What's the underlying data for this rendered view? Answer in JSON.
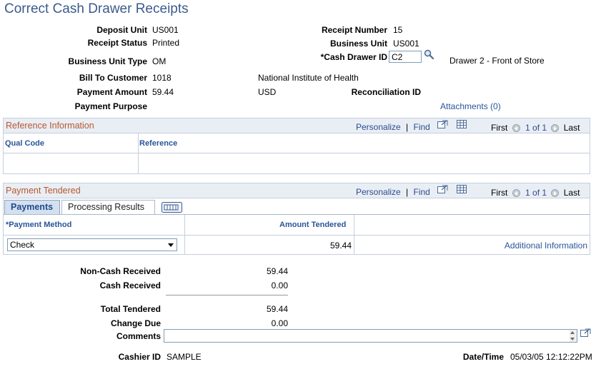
{
  "page_title": "Correct Cash Drawer Receipts",
  "header": {
    "deposit_unit_label": "Deposit Unit",
    "deposit_unit": "US001",
    "receipt_status_label": "Receipt Status",
    "receipt_status": "Printed",
    "bu_type_label": "Business Unit Type",
    "bu_type": "OM",
    "bill_to_label": "Bill To Customer",
    "bill_to": "1018",
    "bill_to_name": "National Institute of Health",
    "payment_amount_label": "Payment Amount",
    "payment_amount": "59.44",
    "currency": "USD",
    "payment_purpose_label": "Payment Purpose",
    "receipt_number_label": "Receipt Number",
    "receipt_number": "15",
    "business_unit_label": "Business Unit",
    "business_unit": "US001",
    "cash_drawer_label": "*Cash Drawer ID",
    "cash_drawer": "C2",
    "drawer_desc": "Drawer 2 - Front of Store",
    "reconciliation_label": "Reconciliation ID",
    "attachments_link": "Attachments (0)"
  },
  "reference_grid": {
    "title": "Reference Information",
    "personalize": "Personalize",
    "sep": "|",
    "find": "Find",
    "first": "First",
    "page_info": "1 of 1",
    "last": "Last",
    "columns": [
      "Qual Code",
      "Reference"
    ]
  },
  "payment_grid": {
    "title": "Payment Tendered",
    "personalize": "Personalize",
    "sep": "|",
    "find": "Find",
    "first": "First",
    "page_info": "1 of 1",
    "last": "Last",
    "tabs": [
      "Payments",
      "Processing Results"
    ],
    "columns": [
      "*Payment Method",
      "Amount Tendered"
    ],
    "row": {
      "method": "Check",
      "amount": "59.44",
      "additional_info": "Additional Information"
    }
  },
  "totals": {
    "non_cash_label": "Non-Cash Received",
    "non_cash": "59.44",
    "cash_label": "Cash Received",
    "cash": "0.00",
    "total_label": "Total Tendered",
    "total": "59.44",
    "change_label": "Change Due",
    "change": "0.00",
    "comments_label": "Comments",
    "comments": ""
  },
  "footer": {
    "cashier_label": "Cashier ID",
    "cashier": "SAMPLE",
    "datetime_label": "Date/Time",
    "datetime": "05/03/05 12:12:22PM"
  },
  "colors": {
    "title": "#3a5b8c",
    "section_title": "#b8572d",
    "link": "#2a5599",
    "grid_border": "#c5cfdc",
    "grid_header_bg": "#e9eef5"
  },
  "icons": [
    "search-icon",
    "view-all-icon",
    "download-icon",
    "show-all-columns-icon"
  ]
}
